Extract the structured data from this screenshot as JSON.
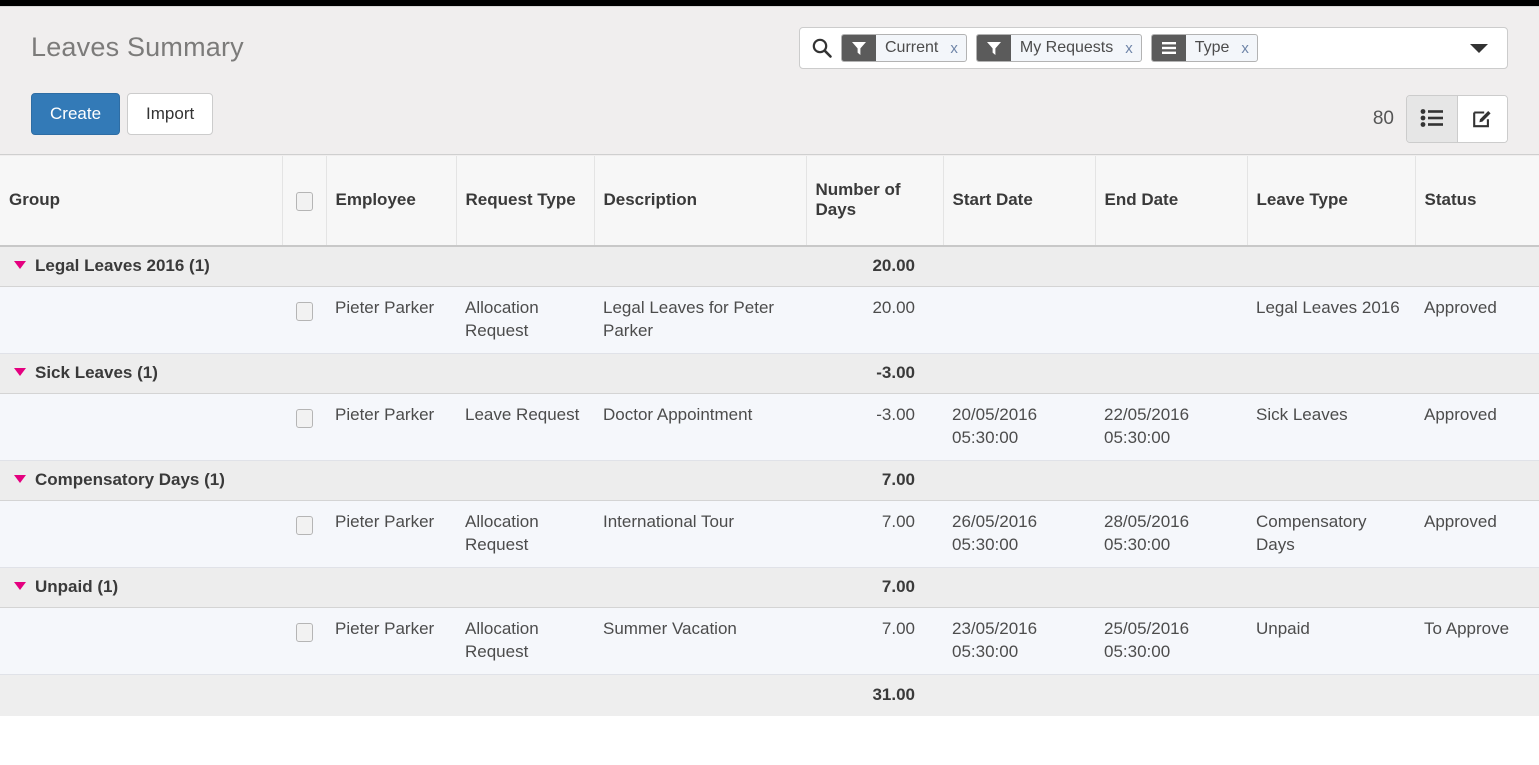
{
  "header": {
    "title": "Leaves Summary",
    "create_label": "Create",
    "import_label": "Import",
    "record_count": "80"
  },
  "search": {
    "icon": "search-icon",
    "caret_icon": "chevron-down-icon",
    "facets": [
      {
        "icon": "filter-icon",
        "label": "Current",
        "remove": "x"
      },
      {
        "icon": "filter-icon",
        "label": "My Requests",
        "remove": "x"
      },
      {
        "icon": "group-by-icon",
        "label": "Type",
        "remove": "x"
      }
    ]
  },
  "view_switcher": {
    "list_icon": "list-view-icon",
    "form_icon": "form-view-icon",
    "active": "list"
  },
  "table": {
    "columns": [
      {
        "key": "group",
        "label": "Group"
      },
      {
        "key": "select",
        "label": ""
      },
      {
        "key": "employee",
        "label": "Employee"
      },
      {
        "key": "request_type",
        "label": "Request Type"
      },
      {
        "key": "description",
        "label": "Description"
      },
      {
        "key": "number_of_days",
        "label": "Number of Days"
      },
      {
        "key": "start_date",
        "label": "Start Date"
      },
      {
        "key": "end_date",
        "label": "End Date"
      },
      {
        "key": "leave_type",
        "label": "Leave Type"
      },
      {
        "key": "status",
        "label": "Status"
      }
    ],
    "groups": [
      {
        "name": "Legal Leaves 2016 (1)",
        "total_days": "20.00",
        "rows": [
          {
            "employee": "Pieter Parker",
            "request_type": "Allocation Request",
            "description": "Legal Leaves for Peter Parker",
            "number_of_days": "20.00",
            "start_date": "",
            "end_date": "",
            "leave_type": "Legal Leaves 2016",
            "status": "Approved"
          }
        ]
      },
      {
        "name": "Sick Leaves (1)",
        "total_days": "-3.00",
        "rows": [
          {
            "employee": "Pieter Parker",
            "request_type": "Leave Request",
            "description": "Doctor Appointment",
            "number_of_days": "-3.00",
            "start_date": "20/05/2016 05:30:00",
            "end_date": "22/05/2016 05:30:00",
            "leave_type": "Sick Leaves",
            "status": "Approved"
          }
        ]
      },
      {
        "name": "Compensatory Days (1)",
        "total_days": "7.00",
        "rows": [
          {
            "employee": "Pieter Parker",
            "request_type": "Allocation Request",
            "description": "International Tour",
            "number_of_days": "7.00",
            "start_date": "26/05/2016 05:30:00",
            "end_date": "28/05/2016 05:30:00",
            "leave_type": "Compensatory Days",
            "status": "Approved"
          }
        ]
      },
      {
        "name": "Unpaid (1)",
        "total_days": "7.00",
        "rows": [
          {
            "employee": "Pieter Parker",
            "request_type": "Allocation Request",
            "description": "Summer Vacation",
            "number_of_days": "7.00",
            "start_date": "23/05/2016 05:30:00",
            "end_date": "25/05/2016 05:30:00",
            "leave_type": "Unpaid",
            "status": "To Approve"
          }
        ]
      }
    ],
    "footer_total": "31.00"
  },
  "colors": {
    "primary_button": "#337ab7",
    "group_caret": "#e4007f",
    "group_marker": "#6c6c9c",
    "facet_icon_bg": "#5b5b5b",
    "facet_bg": "#f3f6fa"
  }
}
